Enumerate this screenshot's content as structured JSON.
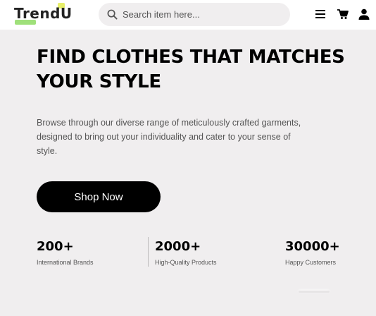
{
  "header": {
    "logo_text": "TrendU",
    "search": {
      "placeholder": "Search item here...",
      "value": ""
    },
    "icons": [
      "menu-icon",
      "cart-icon",
      "user-icon"
    ]
  },
  "hero": {
    "title": "FIND CLOTHES THAT MATCHES YOUR STYLE",
    "description": "Browse through our diverse range of meticulously crafted garments, designed to bring out your individuality and cater to your sense of style.",
    "button_label": "Shop Now"
  },
  "stats": [
    {
      "value": "200+",
      "label": "International Brands"
    },
    {
      "value": "2000+",
      "label": "High-Quality Products"
    },
    {
      "value": "30000+",
      "label": "Happy Customers"
    }
  ],
  "colors": {
    "background": "#f0eeef",
    "header_background": "#ffffff",
    "primary": "#000000",
    "logo_accent_green": "#9fe07a",
    "logo_accent_yellow": "#e7ef6a",
    "muted_text": "#555555"
  }
}
